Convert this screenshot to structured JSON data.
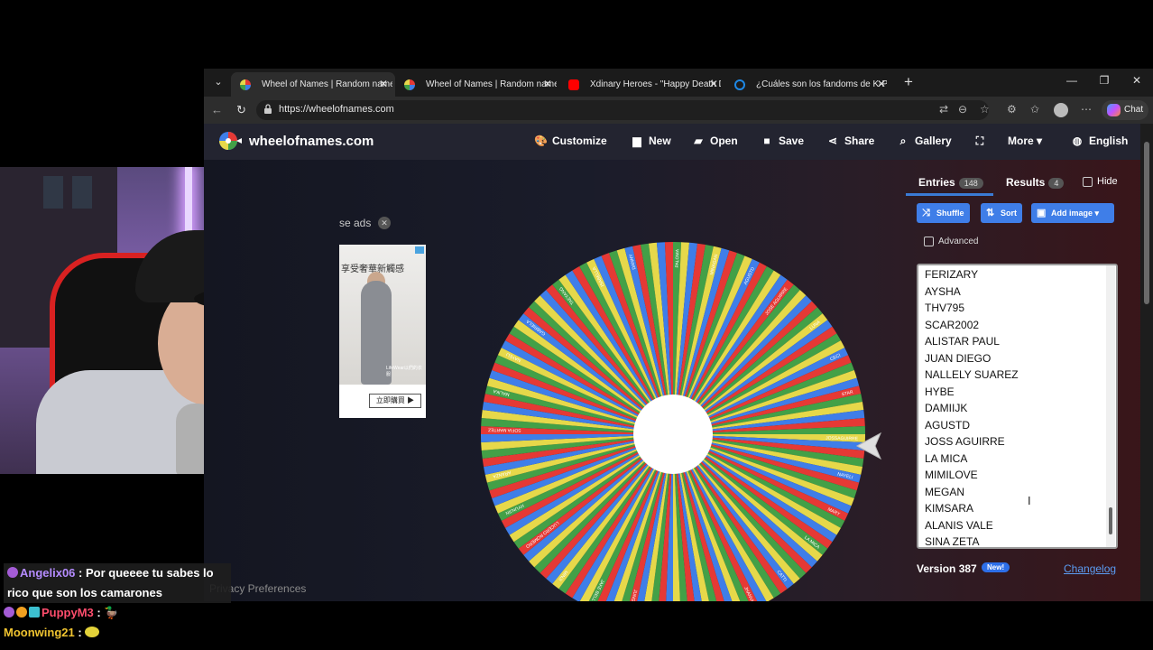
{
  "browser": {
    "tabs": [
      {
        "label": "Wheel of Names | Random name picker",
        "favicon_color": "#4caf50",
        "active": true
      },
      {
        "label": "Wheel of Names | Random name picker",
        "favicon_color": "#4caf50",
        "active": false
      },
      {
        "label": "Xdinary Heroes - \"Happy Death Day\"",
        "favicon_color": "#ff0000",
        "active": false
      },
      {
        "label": "¿Cuáles son los fandoms de K-Pop?",
        "favicon_color": "#1e88e5",
        "active": false
      }
    ],
    "url": "https://wheelofnames.com",
    "chat_label": "Chat"
  },
  "site": {
    "name": "wheelofnames.com",
    "menu": {
      "customize": "Customize",
      "new": "New",
      "open": "Open",
      "save": "Save",
      "share": "Share",
      "gallery": "Gallery",
      "more": "More",
      "language": "English"
    },
    "ad": {
      "close_text": "se ads",
      "headline": "享受奢華新觸感",
      "caption": "LifeWear以們的衣服",
      "button": "立即購買 ▶"
    },
    "privacy": "Privacy Preferences"
  },
  "panel": {
    "entries_tab": "Entries",
    "entries_count": "148",
    "results_tab": "Results",
    "results_count": "4",
    "hide_label": "Hide",
    "shuffle": "Shuffle",
    "sort": "Sort",
    "add_image": "Add image",
    "advanced": "Advanced",
    "entries": [
      "FERIZARY",
      "AYSHA",
      "THV795",
      "SCAR2002",
      "ALISTAR PAUL",
      "JUAN DIEGO",
      "NALLELY SUAREZ",
      "HYBE",
      "DAMIIJK",
      "AGUSTD",
      "JOSS AGUIRRE",
      "LA MICA",
      "MIMILOVE",
      "MEGAN",
      "KIMSARA",
      "ALANIS VALE",
      "SINA ZETA"
    ],
    "version": "Version 387",
    "new_badge": "New!",
    "changelog": "Changelog"
  },
  "wheel": {
    "segment_count": 148,
    "colors": [
      "#e6d84a",
      "#3f7ee8",
      "#e53935",
      "#43a047"
    ],
    "labels_visible": [
      "JOSSAGUIRRE",
      "NAYELI",
      "MARY",
      "LA MICA",
      "CATTI",
      "JHANVI",
      "SOJU",
      "EVIE",
      "JUNGKOOK",
      "JAKE BELL",
      "MINJI",
      "LUCERO ROMERO",
      "HYUNJIN",
      "ARANZA",
      "SOFIA MARTEZ",
      "MALIKA",
      "NAYELI",
      "GABRIELA",
      "TAEYANG",
      "ISABELLA",
      "DANNY",
      "PALOMA",
      "MINAGAN",
      "AGUSTD",
      "JOSE AGUIRRE",
      "LUNA",
      "CECI",
      "STAR"
    ]
  },
  "chat": [
    {
      "user": "Angelix06",
      "message": "Por queeee tu sabes lo rico que son los camarones"
    },
    {
      "user": "PuppyM3",
      "message": ""
    },
    {
      "user": "Moonwing21",
      "message": ""
    }
  ]
}
